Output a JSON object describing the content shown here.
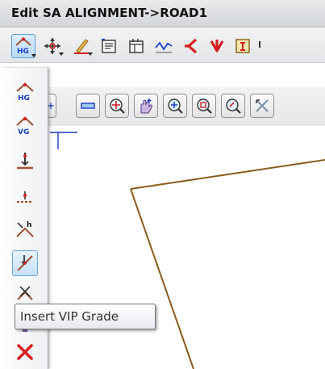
{
  "window": {
    "title": "Edit SA ALIGNMENT->ROAD1"
  },
  "main_toolbar": {
    "items": [
      {
        "icon": "horizontal-geometry-icon",
        "icon_text": "HG",
        "active": true
      },
      {
        "icon": "move-icon"
      },
      {
        "icon": "pen-edit-icon"
      },
      {
        "icon": "properties-list-icon"
      },
      {
        "icon": "report-table-icon"
      },
      {
        "icon": "profile-curve-icon"
      },
      {
        "icon": "red-arrow-left-icon"
      },
      {
        "icon": "red-arrow-down-icon"
      },
      {
        "icon": "info-box-icon"
      }
    ]
  },
  "second_toolbar": {
    "items": [
      {
        "icon": "add-icon"
      },
      {
        "icon": "subtract-icon"
      },
      {
        "icon": "zoom-extent-icon"
      },
      {
        "icon": "pan-hand-icon"
      },
      {
        "icon": "zoom-in-icon"
      },
      {
        "icon": "zoom-window-icon"
      },
      {
        "icon": "zoom-previous-icon"
      },
      {
        "icon": "zoom-fit-icon"
      }
    ]
  },
  "flyout": {
    "items": [
      {
        "name": "horizontal-geometry-item",
        "icon": "horizontal-geometry-icon",
        "icon_text": "HG"
      },
      {
        "name": "vertical-geometry-item",
        "icon": "vertical-geometry-icon",
        "icon_text": "VG"
      },
      {
        "name": "insert-vip-item",
        "icon": "insert-vip-icon"
      },
      {
        "name": "insert-point-item",
        "icon": "insert-point-icon"
      },
      {
        "name": "intersection-h-item",
        "icon": "intersection-h-icon"
      },
      {
        "name": "insert-vip-grade-item",
        "icon": "insert-vip-grade-icon",
        "hover": true
      },
      {
        "name": "delete-vip-item",
        "icon": "delete-vip-icon"
      },
      {
        "name": "move-vip-item",
        "icon": "move-vip-icon"
      },
      {
        "name": "delete-item",
        "icon": "delete-x-icon"
      }
    ]
  },
  "tooltip": {
    "text": "Insert VIP Grade"
  },
  "colors": {
    "alignment_line": "#8b5a1a",
    "crosshair": "#1a3fc4",
    "hover_border": "#6aa6de",
    "red_accent": "#d42020"
  }
}
